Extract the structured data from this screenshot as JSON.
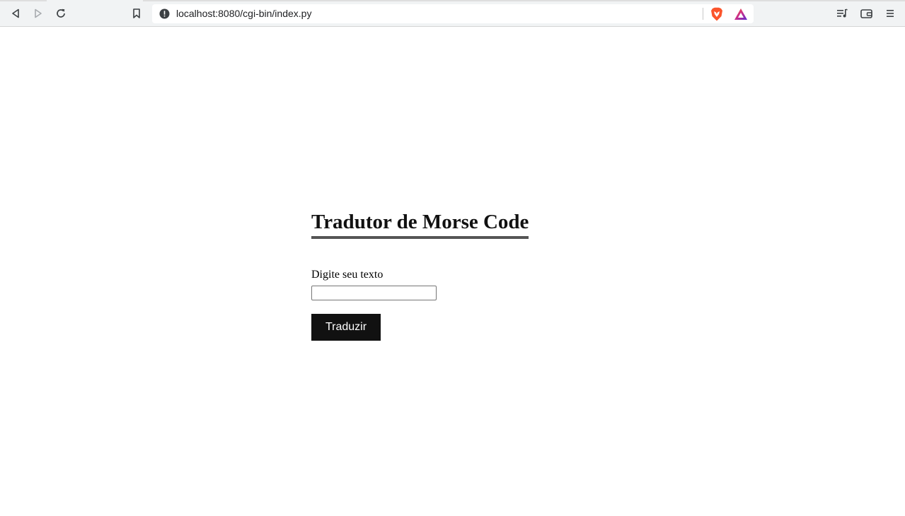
{
  "browser": {
    "url": "localhost:8080/cgi-bin/index.py",
    "icons": {
      "back": "back-arrow-icon",
      "forward": "forward-arrow-icon",
      "reload": "reload-icon",
      "bookmark": "bookmark-icon",
      "site_info": "site-info-icon",
      "brave_shields": "brave-shields-icon",
      "brave_rewards": "brave-rewards-icon",
      "playlist": "playlist-icon",
      "wallet": "wallet-icon",
      "menu": "menu-icon"
    },
    "accent_colors": {
      "brave_orange": "#fb542b",
      "rewards_purple": "#5b2bd1"
    }
  },
  "page": {
    "title": "Tradutor de Morse Code",
    "input_label": "Digite seu texto",
    "input_value": "",
    "submit_label": "Traduzir",
    "colors": {
      "title_underline": "#555555",
      "button_bg": "#111111",
      "button_text": "#ffffff"
    }
  }
}
